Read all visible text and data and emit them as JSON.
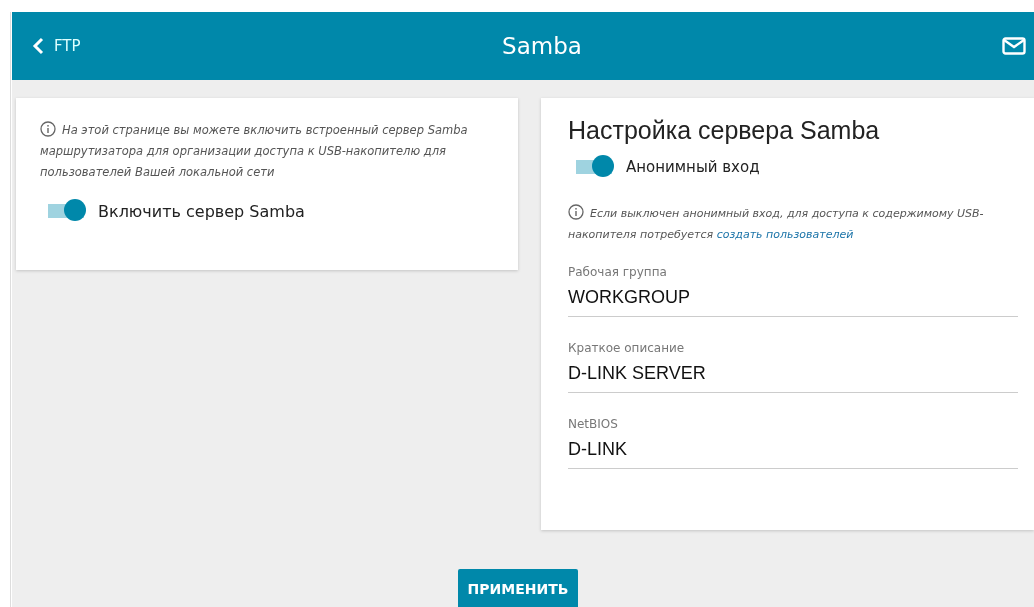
{
  "header": {
    "back_label": "FTP",
    "title": "Samba"
  },
  "left_card": {
    "info": "На этой странице вы можете включить встроенный сервер Samba маршрутизатора для организации доступа к USB-накопителю для пользователей Вашей локальной сети",
    "toggle": {
      "label": "Включить сервер Samba",
      "on": true
    }
  },
  "right_card": {
    "title": "Настройка сервера Samba",
    "toggle": {
      "label": "Анонимный вход",
      "on": true
    },
    "info": {
      "text": "Если выключен анонимный вход, для доступа к содержимому USB-накопителя потребуется",
      "link": "создать пользователей"
    },
    "fields": [
      {
        "label": "Рабочая группа",
        "value": "WORKGROUP"
      },
      {
        "label": "Краткое описание",
        "value": "D-LINK SERVER"
      },
      {
        "label": "NetBIOS",
        "value": "D-LINK"
      }
    ]
  },
  "apply_button": "ПРИМЕНИТЬ"
}
